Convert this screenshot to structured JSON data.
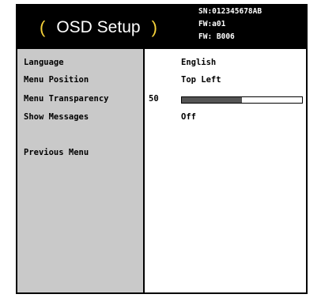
{
  "header": {
    "title": "OSD Setup",
    "paren_left": "(",
    "paren_right": ")",
    "sn": "SN:012345678AB",
    "fw1": "FW:a01",
    "fw2": "FW: B006"
  },
  "menu": {
    "items": [
      {
        "label": "Language",
        "value": "English"
      },
      {
        "label": "Menu Position",
        "value": "Top Left"
      },
      {
        "label": "Menu Transparency",
        "value": "50",
        "slider_level": 0.5
      },
      {
        "label": "Show Messages",
        "value": "Off"
      },
      {
        "label": "Previous Menu"
      }
    ]
  },
  "colors": {
    "background": "#000000",
    "left_panel": "#c9c9c9",
    "right_panel": "#ffffff",
    "paren_accent": "#f6d23a",
    "slider_fill": "#555555"
  }
}
